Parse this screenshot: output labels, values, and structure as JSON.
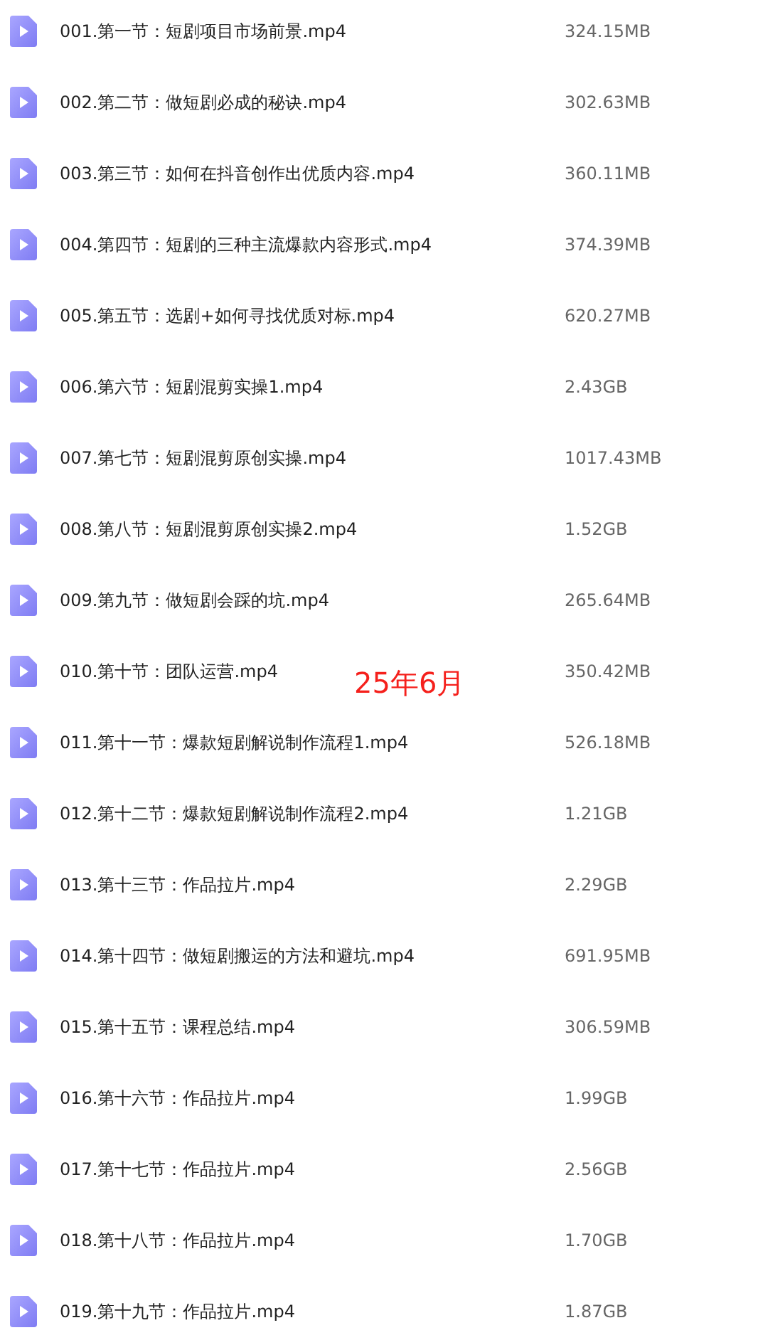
{
  "files": [
    {
      "name": "001.第一节：短剧项目市场前景.mp4",
      "size": "324.15MB"
    },
    {
      "name": "002.第二节：做短剧必成的秘诀.mp4",
      "size": "302.63MB"
    },
    {
      "name": "003.第三节：如何在抖音创作出优质内容.mp4",
      "size": "360.11MB"
    },
    {
      "name": "004.第四节：短剧的三种主流爆款内容形式.mp4",
      "size": "374.39MB"
    },
    {
      "name": "005.第五节：选剧+如何寻找优质对标.mp4",
      "size": "620.27MB"
    },
    {
      "name": "006.第六节：短剧混剪实操1.mp4",
      "size": "2.43GB"
    },
    {
      "name": "007.第七节：短剧混剪原创实操.mp4",
      "size": "1017.43MB"
    },
    {
      "name": "008.第八节：短剧混剪原创实操2.mp4",
      "size": "1.52GB"
    },
    {
      "name": "009.第九节：做短剧会踩的坑.mp4",
      "size": "265.64MB"
    },
    {
      "name": "010.第十节：团队运营.mp4",
      "size": "350.42MB"
    },
    {
      "name": "011.第十一节：爆款短剧解说制作流程1.mp4",
      "size": "526.18MB"
    },
    {
      "name": "012.第十二节：爆款短剧解说制作流程2.mp4",
      "size": "1.21GB"
    },
    {
      "name": "013.第十三节：作品拉片.mp4",
      "size": "2.29GB"
    },
    {
      "name": "014.第十四节：做短剧搬运的方法和避坑.mp4",
      "size": "691.95MB"
    },
    {
      "name": "015.第十五节：课程总结.mp4",
      "size": "306.59MB"
    },
    {
      "name": "016.第十六节：作品拉片.mp4",
      "size": "1.99GB"
    },
    {
      "name": "017.第十七节：作品拉片.mp4",
      "size": "2.56GB"
    },
    {
      "name": "018.第十八节：作品拉片.mp4",
      "size": "1.70GB"
    },
    {
      "name": "019.第十九节：作品拉片.mp4",
      "size": "1.87GB"
    }
  ],
  "overlay_note": "25年6月"
}
